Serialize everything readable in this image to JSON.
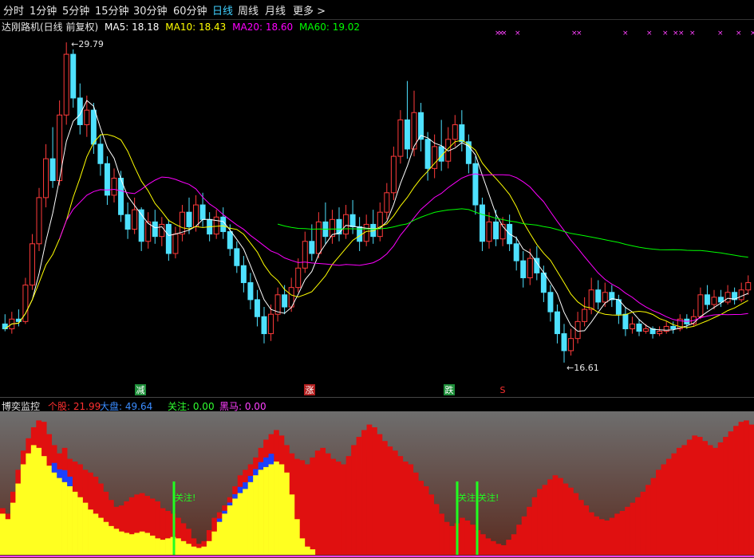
{
  "toolbar": {
    "tabs": [
      "分时",
      "1分钟",
      "5分钟",
      "15分钟",
      "30分钟",
      "60分钟",
      "日线",
      "周线",
      "月线",
      "更多 >"
    ],
    "active_index": 6
  },
  "legend": {
    "title": "达刚路机(日线 前复权)",
    "ma5": "MA5: 18.18",
    "ma10": "MA10: 18.43",
    "ma20": "MA20: 18.60",
    "ma60": "MA60: 19.02",
    "colors": {
      "ma5": "#ffffff",
      "ma10": "#ffff00",
      "ma20": "#ff00ff",
      "ma60": "#00ff00"
    }
  },
  "annotations": {
    "high_label": "29.79",
    "low_label": "16.61",
    "signals": [
      "减",
      "涨",
      "跌",
      "S"
    ]
  },
  "indicator": {
    "title": "博奕监控",
    "stock": "个股: 21.99",
    "market": "大盘: 49.64",
    "focus": "关注: 0.00",
    "darkhorse": "黑马: 0.00",
    "focus_marks": [
      "关注!",
      "关注!",
      "关注!"
    ]
  },
  "chart_data": {
    "type": "candlestick",
    "price_range": [
      16.61,
      29.79
    ],
    "candles": [
      [
        18.2,
        18.0,
        18.6,
        17.9
      ],
      [
        18.0,
        18.4,
        18.7,
        17.8
      ],
      [
        18.4,
        18.3,
        18.8,
        18.1
      ],
      [
        18.3,
        19.8,
        20.1,
        18.2
      ],
      [
        19.8,
        21.5,
        21.9,
        19.6
      ],
      [
        21.5,
        23.4,
        23.8,
        21.2
      ],
      [
        23.4,
        25.0,
        25.6,
        23.0
      ],
      [
        25.0,
        24.1,
        26.3,
        23.8
      ],
      [
        24.1,
        26.8,
        27.4,
        23.9
      ],
      [
        26.8,
        29.3,
        29.79,
        26.4
      ],
      [
        29.3,
        27.5,
        29.5,
        27.1
      ],
      [
        27.5,
        26.4,
        28.1,
        26.0
      ],
      [
        26.4,
        27.0,
        27.6,
        25.9
      ],
      [
        27.0,
        25.6,
        27.3,
        25.2
      ],
      [
        25.6,
        24.8,
        26.0,
        24.3
      ],
      [
        24.8,
        23.5,
        25.1,
        23.1
      ],
      [
        23.5,
        24.2,
        24.6,
        23.2
      ],
      [
        24.2,
        22.7,
        24.5,
        22.4
      ],
      [
        22.7,
        22.1,
        23.2,
        21.7
      ],
      [
        22.1,
        22.9,
        23.4,
        21.9
      ],
      [
        22.9,
        21.6,
        23.0,
        21.2
      ],
      [
        21.6,
        22.4,
        22.8,
        21.3
      ],
      [
        22.4,
        21.8,
        22.9,
        21.5
      ],
      [
        21.8,
        22.3,
        22.6,
        21.4
      ],
      [
        22.3,
        21.1,
        22.5,
        20.8
      ],
      [
        21.1,
        21.9,
        22.2,
        20.9
      ],
      [
        21.9,
        22.8,
        23.1,
        21.6
      ],
      [
        22.8,
        22.2,
        23.4,
        21.9
      ],
      [
        22.2,
        23.1,
        23.5,
        22.0
      ],
      [
        23.1,
        22.5,
        23.6,
        22.2
      ],
      [
        22.5,
        21.9,
        22.8,
        21.6
      ],
      [
        21.9,
        22.6,
        22.9,
        21.7
      ],
      [
        22.6,
        22.0,
        23.0,
        21.7
      ],
      [
        22.0,
        21.3,
        22.3,
        21.0
      ],
      [
        21.3,
        20.6,
        21.6,
        20.3
      ],
      [
        20.6,
        19.9,
        21.0,
        19.5
      ],
      [
        19.9,
        19.2,
        20.3,
        18.8
      ],
      [
        19.2,
        18.5,
        19.6,
        18.1
      ],
      [
        18.5,
        17.8,
        18.9,
        17.4
      ],
      [
        17.8,
        18.6,
        19.0,
        17.5
      ],
      [
        18.6,
        19.4,
        19.7,
        18.3
      ],
      [
        19.4,
        18.9,
        19.8,
        18.6
      ],
      [
        18.9,
        19.7,
        20.1,
        18.7
      ],
      [
        19.7,
        20.5,
        20.9,
        19.5
      ],
      [
        20.5,
        21.6,
        22.0,
        20.3
      ],
      [
        21.6,
        21.1,
        22.3,
        20.8
      ],
      [
        21.1,
        22.4,
        22.8,
        20.9
      ],
      [
        22.4,
        21.8,
        23.2,
        21.5
      ],
      [
        21.8,
        22.5,
        22.9,
        21.5
      ],
      [
        22.5,
        21.9,
        23.0,
        21.6
      ],
      [
        21.9,
        22.7,
        23.1,
        21.7
      ],
      [
        22.7,
        22.2,
        23.3,
        21.9
      ],
      [
        22.2,
        21.6,
        22.6,
        21.2
      ],
      [
        21.6,
        22.3,
        22.7,
        21.4
      ],
      [
        22.3,
        21.8,
        22.9,
        21.5
      ],
      [
        21.8,
        22.8,
        23.2,
        21.6
      ],
      [
        22.8,
        23.6,
        24.0,
        22.5
      ],
      [
        23.6,
        25.1,
        25.5,
        23.3
      ],
      [
        25.1,
        26.6,
        27.0,
        24.8
      ],
      [
        26.6,
        25.4,
        28.2,
        25.0
      ],
      [
        25.4,
        26.9,
        27.8,
        25.1
      ],
      [
        26.9,
        25.8,
        27.3,
        25.3
      ],
      [
        25.8,
        24.6,
        26.1,
        24.1
      ],
      [
        24.6,
        25.5,
        26.0,
        24.2
      ],
      [
        25.5,
        24.9,
        26.6,
        24.5
      ],
      [
        24.9,
        25.8,
        26.3,
        24.6
      ],
      [
        25.8,
        26.4,
        26.8,
        25.5
      ],
      [
        26.4,
        25.7,
        27.0,
        25.3
      ],
      [
        25.7,
        24.8,
        26.0,
        24.4
      ],
      [
        24.8,
        23.1,
        25.1,
        22.7
      ],
      [
        23.1,
        21.6,
        23.4,
        21.2
      ],
      [
        21.6,
        22.4,
        22.8,
        21.3
      ],
      [
        22.4,
        21.7,
        22.9,
        21.4
      ],
      [
        21.7,
        22.3,
        22.6,
        21.4
      ],
      [
        22.3,
        21.5,
        22.7,
        21.2
      ],
      [
        21.5,
        20.8,
        21.8,
        20.4
      ],
      [
        20.8,
        20.1,
        21.2,
        19.7
      ],
      [
        20.1,
        20.9,
        21.3,
        19.8
      ],
      [
        20.9,
        20.3,
        21.4,
        20.0
      ],
      [
        20.3,
        19.5,
        20.6,
        19.1
      ],
      [
        19.5,
        18.7,
        19.8,
        18.3
      ],
      [
        18.7,
        17.8,
        19.0,
        17.4
      ],
      [
        17.8,
        17.1,
        18.2,
        16.61
      ],
      [
        17.1,
        17.6,
        18.0,
        16.9
      ],
      [
        17.6,
        18.3,
        18.7,
        17.4
      ],
      [
        18.3,
        18.8,
        19.3,
        18.1
      ],
      [
        18.8,
        19.6,
        20.1,
        18.6
      ],
      [
        19.6,
        19.1,
        20.0,
        18.8
      ],
      [
        19.1,
        19.5,
        19.9,
        18.9
      ],
      [
        19.5,
        19.2,
        19.8,
        18.9
      ],
      [
        19.2,
        18.6,
        19.4,
        18.2
      ],
      [
        18.6,
        18.0,
        18.9,
        17.7
      ],
      [
        18.0,
        18.2,
        18.5,
        17.8
      ],
      [
        18.2,
        17.9,
        18.4,
        17.7
      ],
      [
        17.9,
        18.0,
        18.2,
        17.8
      ],
      [
        18.0,
        17.8,
        18.1,
        17.6
      ],
      [
        17.8,
        17.9,
        18.1,
        17.7
      ],
      [
        17.9,
        18.1,
        18.3,
        17.8
      ],
      [
        18.1,
        18.0,
        18.3,
        17.8
      ],
      [
        18.0,
        18.4,
        18.6,
        17.9
      ],
      [
        18.4,
        18.2,
        18.6,
        18.0
      ],
      [
        18.2,
        18.5,
        18.8,
        18.1
      ],
      [
        18.5,
        19.4,
        19.7,
        18.4
      ],
      [
        19.4,
        19.0,
        19.8,
        18.8
      ],
      [
        19.0,
        19.3,
        19.6,
        18.8
      ],
      [
        19.3,
        19.1,
        19.6,
        18.9
      ],
      [
        19.1,
        19.5,
        19.8,
        19.0
      ],
      [
        19.5,
        19.2,
        19.7,
        19.0
      ],
      [
        19.2,
        19.6,
        19.9,
        19.1
      ],
      [
        19.6,
        19.9,
        20.2,
        19.4
      ]
    ],
    "oscillator": [
      0.34,
      0.3,
      0.46,
      0.62,
      0.76,
      0.85,
      0.93,
      0.98,
      0.97,
      0.88,
      0.8,
      0.74,
      0.78,
      0.7,
      0.68,
      0.66,
      0.62,
      0.6,
      0.57,
      0.52,
      0.46,
      0.4,
      0.35,
      0.36,
      0.39,
      0.42,
      0.44,
      0.45,
      0.43,
      0.41,
      0.39,
      0.34,
      0.32,
      0.3,
      0.27,
      0.23,
      0.19,
      0.12,
      0.08,
      0.1,
      0.18,
      0.27,
      0.31,
      0.36,
      0.42,
      0.5,
      0.58,
      0.62,
      0.66,
      0.71,
      0.78,
      0.84,
      0.88,
      0.91,
      0.87,
      0.8,
      0.74,
      0.7,
      0.69,
      0.66,
      0.71,
      0.76,
      0.78,
      0.74,
      0.7,
      0.68,
      0.66,
      0.72,
      0.8,
      0.86,
      0.91,
      0.95,
      0.93,
      0.88,
      0.83,
      0.79,
      0.76,
      0.72,
      0.68,
      0.66,
      0.6,
      0.54,
      0.5,
      0.44,
      0.37,
      0.3,
      0.24,
      0.21,
      0.23,
      0.27,
      0.25,
      0.22,
      0.18,
      0.15,
      0.12,
      0.1,
      0.08,
      0.07,
      0.11,
      0.15,
      0.22,
      0.28,
      0.35,
      0.42,
      0.48,
      0.51,
      0.55,
      0.58,
      0.56,
      0.52,
      0.49,
      0.45,
      0.4,
      0.36,
      0.31,
      0.28,
      0.26,
      0.25,
      0.27,
      0.3,
      0.32,
      0.35,
      0.38,
      0.42,
      0.46,
      0.51,
      0.56,
      0.62,
      0.66,
      0.7,
      0.74,
      0.78,
      0.8,
      0.84,
      0.87,
      0.86,
      0.83,
      0.8,
      0.78,
      0.82,
      0.86,
      0.9,
      0.94,
      0.97,
      0.98,
      0.95
    ],
    "stock_strength": [
      0.3,
      0.26,
      0.38,
      0.52,
      0.66,
      0.74,
      0.8,
      0.78,
      0.72,
      0.65,
      0.6,
      0.56,
      0.53,
      0.5,
      0.46,
      0.42,
      0.38,
      0.33,
      0.3,
      0.27,
      0.24,
      0.21,
      0.19,
      0.17,
      0.16,
      0.15,
      0.16,
      0.17,
      0.16,
      0.14,
      0.12,
      0.11,
      0.12,
      0.13,
      0.12,
      0.1,
      0.08,
      0.06,
      0.05,
      0.06,
      0.1,
      0.17,
      0.24,
      0.3,
      0.36,
      0.41,
      0.45,
      0.48,
      0.53,
      0.58,
      0.62,
      0.64,
      0.66,
      0.68,
      0.66,
      0.6,
      0.44,
      0.26,
      0.12,
      0.06,
      0.04,
      0.02,
      0.01,
      0.01,
      0.01,
      0.01,
      0.01,
      0.01,
      0.01,
      0.01,
      0.01,
      0.01,
      0.01,
      0.01,
      0.01,
      0.01,
      0.01,
      0.01,
      0.01,
      0.01,
      0.01,
      0.01,
      0.01,
      0.01,
      0.01,
      0.01,
      0.01,
      0.01,
      0.01,
      0.01,
      0.01,
      0.01,
      0.01,
      0.01,
      0.01,
      0.01,
      0.01,
      0.01,
      0.01,
      0.01,
      0.01,
      0.01,
      0.01,
      0.01,
      0.01,
      0.01,
      0.01,
      0.01,
      0.01,
      0.01,
      0.01,
      0.01,
      0.01,
      0.01,
      0.01,
      0.01,
      0.01,
      0.01,
      0.01,
      0.01,
      0.01,
      0.01,
      0.01,
      0.01,
      0.01,
      0.01,
      0.01,
      0.01,
      0.01,
      0.01,
      0.01,
      0.01,
      0.01,
      0.01,
      0.01,
      0.01,
      0.01,
      0.01,
      0.01,
      0.01,
      0.01,
      0.01,
      0.01,
      0.01,
      0.01,
      0.01
    ]
  }
}
